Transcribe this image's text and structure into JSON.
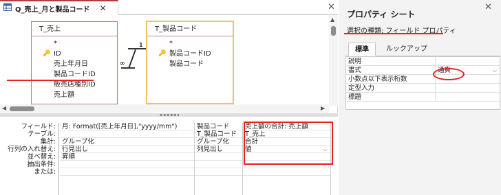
{
  "query_tab": {
    "title": "Q_売上_月と製品コード"
  },
  "table_sales": {
    "title": "T_売上",
    "star": "*",
    "fields": [
      "ID",
      "売上年月日",
      "製品コードID",
      "販売店種別ID",
      "売上額"
    ]
  },
  "table_product": {
    "title": "T_製品コード",
    "star": "*",
    "fields": [
      "製品コードID",
      "製品コード"
    ]
  },
  "relationship": {
    "one": "1",
    "many": "∞"
  },
  "grid": {
    "row_labels": [
      "フィールド:",
      "テーブル:",
      "集計:",
      "行列の入れ替え:",
      "並べ替え:",
      "抽出条件:",
      "または:"
    ],
    "columns": [
      {
        "cells": [
          "月: Format([売上年月日],\"yyyy/mm\")",
          "",
          "グループ化",
          "行見出し",
          "昇順",
          "",
          ""
        ]
      },
      {
        "cells": [
          "製品コード",
          "T_製品コード",
          "グループ化",
          "列見出し",
          "",
          "",
          ""
        ]
      },
      {
        "cells": [
          "売上額の合計: 売上額",
          "T_売上",
          "合計",
          "値",
          "",
          "",
          ""
        ]
      }
    ]
  },
  "property_sheet": {
    "title": "プロパティ シート",
    "selection_type": "選択の種類: フィールド プロパティ",
    "tabs": [
      "標準",
      "ルックアップ"
    ],
    "active_tab": "標準",
    "rows": [
      {
        "name": "説明",
        "value": ""
      },
      {
        "name": "書式",
        "value": "通貨"
      },
      {
        "name": "小数点以下表示桁数",
        "value": ""
      },
      {
        "name": "定型入力",
        "value": ""
      },
      {
        "name": "標題",
        "value": ""
      }
    ]
  },
  "colors": {
    "highlight": "#e5221f",
    "selected_table_border": "#f3c25a",
    "tab_accent": "#b53a3a"
  }
}
